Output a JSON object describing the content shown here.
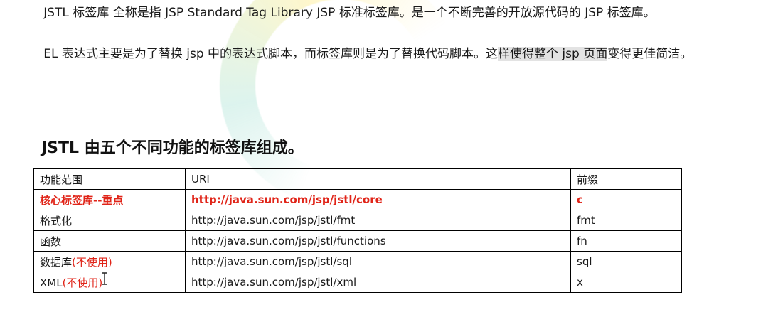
{
  "paragraphs": {
    "p1": "JSTL 标签库  全称是指 JSP Standard Tag Library   JSP 标准标签库。是一个不断完善的开放源代码的 JSP 标签库。",
    "p2_a": "EL 表达式主要是为了替换 jsp 中的表达式脚本，而标签库则是为了替换代码脚本。这",
    "p2_b": "样使得整个 jsp 页面",
    "p2_c": "变得更佳简洁。"
  },
  "section_title": "JSTL 由五个不同功能的标签库组成。",
  "table": {
    "headers": [
      "功能范围",
      "URI",
      "前缀"
    ],
    "rows": [
      {
        "name": "核心标签库--重点",
        "note": "",
        "uri": "http://java.sun.com/jsp/jstl/core",
        "prefix": "c"
      },
      {
        "name": "格式化",
        "note": "",
        "uri": "http://java.sun.com/jsp/jstl/fmt",
        "prefix": "fmt"
      },
      {
        "name": "函数",
        "note": "",
        "uri": "http://java.sun.com/jsp/jstl/functions",
        "prefix": "fn"
      },
      {
        "name": "数据库",
        "note": "(不使用)",
        "uri": "http://java.sun.com/jsp/jstl/sql",
        "prefix": "sql"
      },
      {
        "name": "XML",
        "note": "(不使用)",
        "uri": "http://java.sun.com/jsp/jstl/xml",
        "prefix": "x"
      }
    ]
  },
  "colors": {
    "highlight_red": "#e02418",
    "selection_gray": "#e3e3e3"
  },
  "icons": {
    "cursor": "text-cursor-icon"
  }
}
